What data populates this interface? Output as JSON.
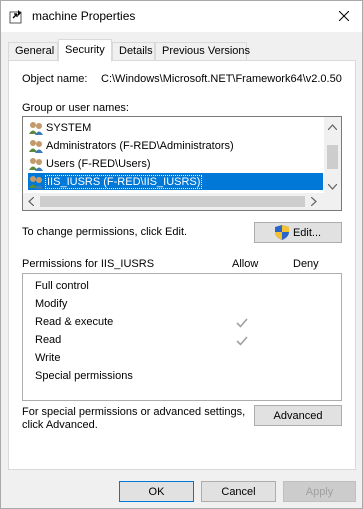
{
  "window": {
    "title": "machine Properties"
  },
  "tabs": [
    {
      "label": "General",
      "active": false
    },
    {
      "label": "Security",
      "active": true
    },
    {
      "label": "Details",
      "active": false
    },
    {
      "label": "Previous Versions",
      "active": false
    }
  ],
  "object": {
    "label": "Object name:",
    "value": "C:\\Windows\\Microsoft.NET\\Framework64\\v2.0.50"
  },
  "groups": {
    "label": "Group or user names:",
    "items": [
      {
        "label": "SYSTEM",
        "selected": false
      },
      {
        "label": "Administrators (F-RED\\Administrators)",
        "selected": false
      },
      {
        "label": "Users (F-RED\\Users)",
        "selected": false
      },
      {
        "label": "IIS_IUSRS (F-RED\\IIS_IUSRS)",
        "selected": true
      }
    ]
  },
  "change_hint": "To change permissions, click Edit.",
  "edit_button": "Edit...",
  "permissions": {
    "header": "Permissions for IIS_IUSRS",
    "allow_label": "Allow",
    "deny_label": "Deny",
    "rows": [
      {
        "name": "Full control",
        "allow": false,
        "deny": false
      },
      {
        "name": "Modify",
        "allow": false,
        "deny": false
      },
      {
        "name": "Read & execute",
        "allow": true,
        "deny": false
      },
      {
        "name": "Read",
        "allow": true,
        "deny": false
      },
      {
        "name": "Write",
        "allow": false,
        "deny": false
      },
      {
        "name": "Special permissions",
        "allow": false,
        "deny": false
      }
    ]
  },
  "advanced": {
    "hint_line1": "For special permissions or advanced settings,",
    "hint_line2": "click Advanced.",
    "button": "Advanced"
  },
  "footer": {
    "ok": "OK",
    "cancel": "Cancel",
    "apply": "Apply"
  },
  "colors": {
    "selection": "#0078d7",
    "check_gray": "#a0a0a0"
  }
}
